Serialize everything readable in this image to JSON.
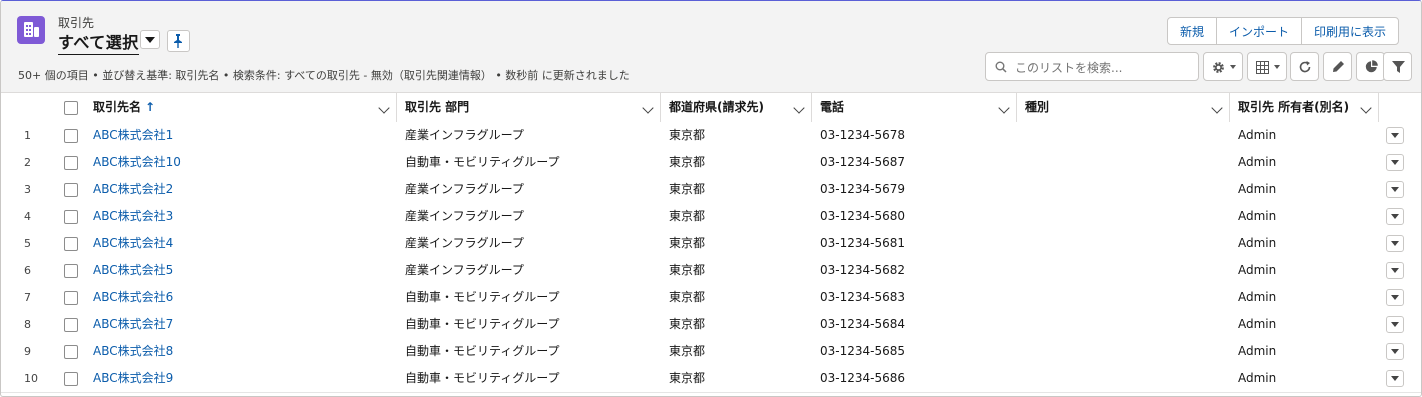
{
  "header": {
    "object_label": "取引先",
    "list_view_name": "すべて選択",
    "meta_text": "50+ 個の項目 • 並び替え基準: 取引先名 • 検索条件: すべての取引先 - 無効（取引先関連情報） • 数秒前 に更新されました",
    "actions": [
      {
        "label": "新規"
      },
      {
        "label": "インポート"
      },
      {
        "label": "印刷用に表示"
      }
    ],
    "search_placeholder": "このリストを検索...",
    "accent_color": "#7f5ad6",
    "link_color": "#0b5cab"
  },
  "table": {
    "columns": [
      {
        "label": "取引先名",
        "sort": "ascending"
      },
      {
        "label": "取引先 部門"
      },
      {
        "label": "都道府県(請求先)"
      },
      {
        "label": "電話"
      },
      {
        "label": "種別"
      },
      {
        "label": "取引先 所有者(別名)"
      }
    ],
    "rows": [
      {
        "num": "1",
        "name": "ABC株式会社1",
        "division": "産業インフラグループ",
        "state": "東京都",
        "phone": "03-1234-5678",
        "type": "",
        "owner": "Admin"
      },
      {
        "num": "2",
        "name": "ABC株式会社10",
        "division": "自動車・モビリティグループ",
        "state": "東京都",
        "phone": "03-1234-5687",
        "type": "",
        "owner": "Admin"
      },
      {
        "num": "3",
        "name": "ABC株式会社2",
        "division": "産業インフラグループ",
        "state": "東京都",
        "phone": "03-1234-5679",
        "type": "",
        "owner": "Admin"
      },
      {
        "num": "4",
        "name": "ABC株式会社3",
        "division": "産業インフラグループ",
        "state": "東京都",
        "phone": "03-1234-5680",
        "type": "",
        "owner": "Admin"
      },
      {
        "num": "5",
        "name": "ABC株式会社4",
        "division": "産業インフラグループ",
        "state": "東京都",
        "phone": "03-1234-5681",
        "type": "",
        "owner": "Admin"
      },
      {
        "num": "6",
        "name": "ABC株式会社5",
        "division": "産業インフラグループ",
        "state": "東京都",
        "phone": "03-1234-5682",
        "type": "",
        "owner": "Admin"
      },
      {
        "num": "7",
        "name": "ABC株式会社6",
        "division": "自動車・モビリティグループ",
        "state": "東京都",
        "phone": "03-1234-5683",
        "type": "",
        "owner": "Admin"
      },
      {
        "num": "8",
        "name": "ABC株式会社7",
        "division": "自動車・モビリティグループ",
        "state": "東京都",
        "phone": "03-1234-5684",
        "type": "",
        "owner": "Admin"
      },
      {
        "num": "9",
        "name": "ABC株式会社8",
        "division": "自動車・モビリティグループ",
        "state": "東京都",
        "phone": "03-1234-5685",
        "type": "",
        "owner": "Admin"
      },
      {
        "num": "10",
        "name": "ABC株式会社9",
        "division": "自動車・モビリティグループ",
        "state": "東京都",
        "phone": "03-1234-5686",
        "type": "",
        "owner": "Admin"
      }
    ]
  },
  "icons": [
    "account-object-icon",
    "chevron-down-icon",
    "pin-icon",
    "search-icon",
    "gear-icon",
    "table-view-icon",
    "refresh-icon",
    "edit-icon",
    "chart-icon",
    "filter-icon"
  ]
}
